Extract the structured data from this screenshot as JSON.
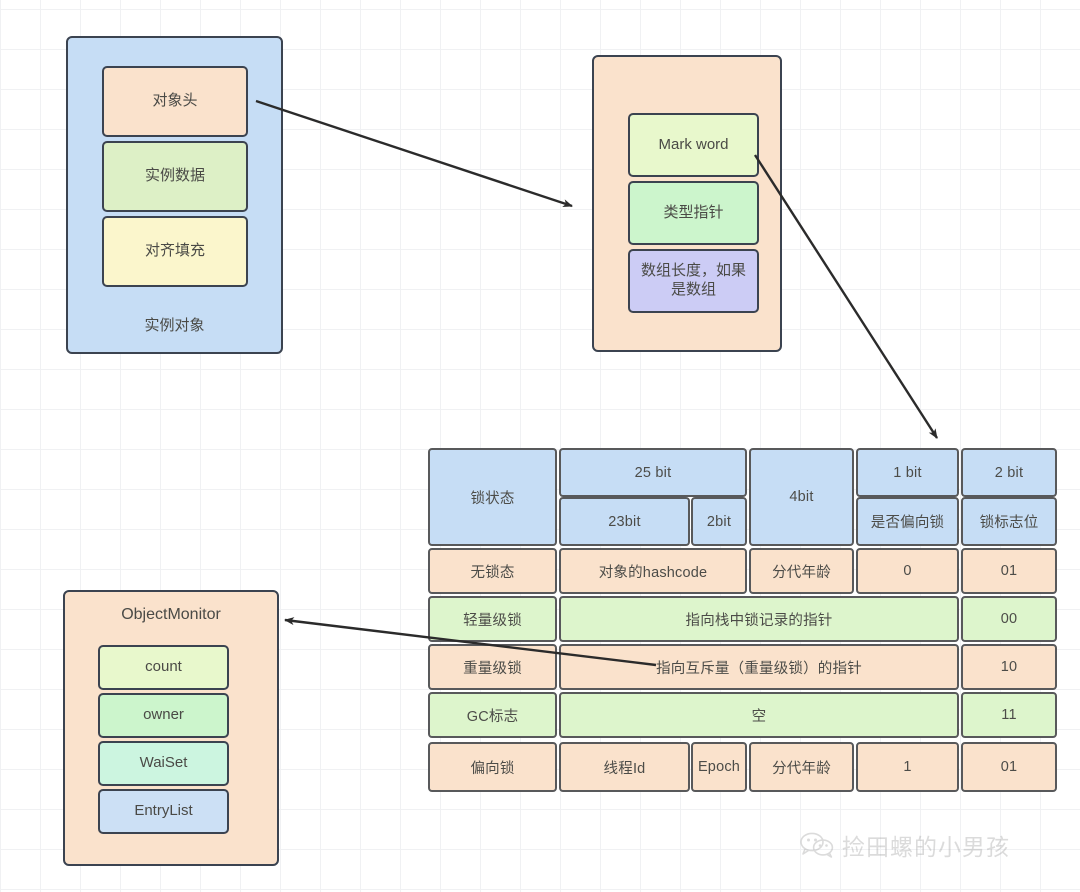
{
  "diagram": {
    "title": "Java object header / Mark Word lock state diagram",
    "colors": {
      "border": "#3b4350",
      "blue": "#c6ddf5",
      "peach": "#fae2cc",
      "green": "#ddf0c6",
      "yellow": "#fbf6cc",
      "purple": "#ccccf5",
      "mint": "#ccf5e0",
      "lightgreen": "#e8f8cc",
      "midgreen": "#ccf5cc",
      "lightblue": "#cce0f5",
      "table_blue": "#c6ddf5",
      "table_peach": "#fae2cc",
      "table_green": "#ddf5cc"
    },
    "instance_object": {
      "outer_label": "实例对象",
      "rows": [
        {
          "label": "对象头",
          "color": "#fae2cc"
        },
        {
          "label": "实例数据",
          "color": "#ddf0c6"
        },
        {
          "label": "对齐填充",
          "color": "#fbf6cc"
        }
      ]
    },
    "object_header": {
      "rows": [
        {
          "label": "Mark  word",
          "color": "#e8f8cc"
        },
        {
          "label": "类型指针",
          "color": "#ccf5cc"
        },
        {
          "label": "数组长度，如果是数组",
          "color": "#ccccf5"
        }
      ]
    },
    "object_monitor": {
      "title": "ObjectMonitor",
      "rows": [
        {
          "label": "count",
          "color": "#e8f8cc"
        },
        {
          "label": "owner",
          "color": "#ccf5cc"
        },
        {
          "label": "WaiSet",
          "color": "#ccf5e0"
        },
        {
          "label": "EntryList",
          "color": "#cce0f5"
        }
      ]
    },
    "markword_table": {
      "header": {
        "state_label": "锁状态",
        "group_25bit": "25 bit",
        "sub_23bit": "23bit",
        "sub_2bit": "2bit",
        "group_4bit": "4bit",
        "group_1bit": "1 bit",
        "sub_1bit": "是否偏向锁",
        "group_2bit": "2 bit",
        "sub_2bit_right": "锁标志位"
      },
      "rows": [
        {
          "state": "无锁态",
          "color": "#fae2cc",
          "cells": [
            "对象的hashcode",
            "分代年龄",
            "0",
            "01"
          ],
          "layout": "four"
        },
        {
          "state": "轻量级锁",
          "color": "#ddf5cc",
          "cells": [
            "指向栈中锁记录的指针",
            "00"
          ],
          "layout": "wide"
        },
        {
          "state": "重量级锁",
          "color": "#fae2cc",
          "cells": [
            "指向互斥量（重量级锁）的指针",
            "10"
          ],
          "layout": "wide"
        },
        {
          "state": "GC标志",
          "color": "#ddf5cc",
          "cells": [
            "空",
            "11"
          ],
          "layout": "wide"
        },
        {
          "state": "偏向锁",
          "color": "#fae2cc",
          "cells": [
            "线程Id",
            "Epoch",
            "分代年龄",
            "1",
            "01"
          ],
          "layout": "five"
        }
      ]
    },
    "watermark": {
      "text": "捡田螺的小男孩",
      "icon": "wechat-icon"
    }
  }
}
